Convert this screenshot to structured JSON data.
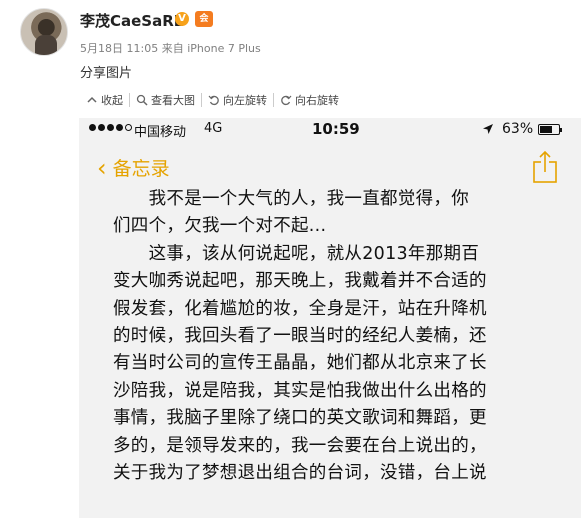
{
  "post": {
    "username": "李茂CaeSaRL",
    "verified_mark": "V",
    "member_badge": "会",
    "date": "5月18日 11:05",
    "source_prefix": "来自",
    "source": "iPhone 7 Plus",
    "text": "分享图片"
  },
  "toolbar": {
    "items": [
      {
        "label": "收起",
        "icon": "collapse-icon"
      },
      {
        "label": "查看大图",
        "icon": "zoom-icon"
      },
      {
        "label": "向左旋转",
        "icon": "rotate-left-icon"
      },
      {
        "label": "向右旋转",
        "icon": "rotate-right-icon"
      }
    ]
  },
  "phone": {
    "statusbar": {
      "carrier": "中国移动",
      "network": "4G",
      "time": "10:59",
      "battery": "63%",
      "battery_level": 0.63
    },
    "navbar": {
      "back_label": "备忘录",
      "accent": "#e5a300"
    },
    "note": {
      "lines": [
        "　　我不是一个大气的人，我一直都觉得，你",
        "们四个，欠我一个对不起...",
        "　　这事，该从何说起呢，就从2013年那期百",
        "变大咖秀说起吧，那天晚上，我戴着并不合适的",
        "假发套，化着尴尬的妆，全身是汗，站在升降机",
        "的时候，我回头看了一眼当时的经纪人姜楠，还",
        "有当时公司的宣传王晶晶，她们都从北京来了长",
        "沙陪我，说是陪我，其实是怕我做出什么出格的",
        "事情，我脑子里除了绕口的英文歌词和舞蹈，更",
        "多的，是领导发来的，我一会要在台上说出的，",
        "关于我为了梦想退出组合的台词，没错，台上说"
      ]
    }
  }
}
